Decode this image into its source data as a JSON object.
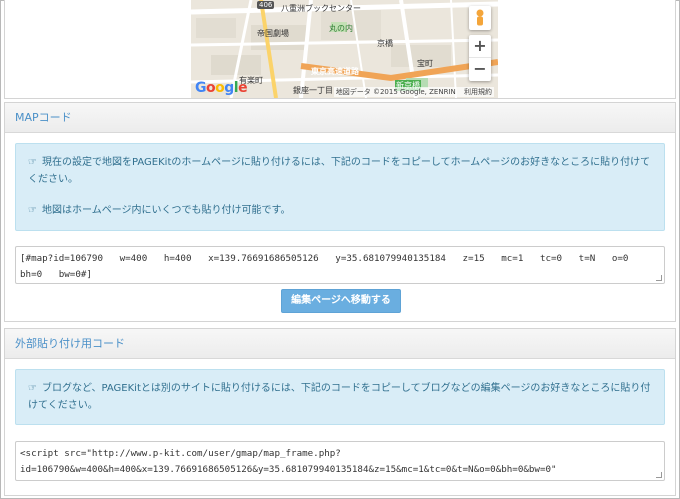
{
  "map": {
    "labels": {
      "route": "406",
      "yaesu": "八重洲ブックセンター",
      "marunouchi": "丸の内",
      "kyobashi": "京橋",
      "tokyo_square": "東京スクエアガーデン",
      "imperial": "帝国劇場",
      "takaracho": "宝町",
      "yurakucho": "有楽町",
      "expressway": "東京高速道路",
      "ginza_itchome": "銀座一丁目",
      "shinkyobashi": "新京橋"
    },
    "logo": "Google",
    "attribution": "地図データ ©2015 Google, ZENRIN",
    "terms": "利用規約",
    "zoom_in": "+",
    "zoom_out": "−"
  },
  "map_code": {
    "title": "MAPコード",
    "info_line1": "現在の設定で地図をPAGEKitのホームページに貼り付けるには、下記のコードをコピーしてホームページのお好きなところに貼り付けてください。",
    "info_line2": "地図はホームページ内にいくつでも貼り付け可能です。",
    "code": "[#map?id=106790   w=400   h=400   x=139.76691686505126   y=35.681079940135184   z=15   mc=1   tc=0   t=N   o=0\nbh=0   bw=0#]",
    "button": "編集ページへ移動する"
  },
  "external_code": {
    "title": "外部貼り付け用コード",
    "info": "ブログなど、PAGEKitとは別のサイトに貼り付けるには、下記のコードをコピーしてブログなどの編集ページのお好きなところに貼り付けてください。",
    "code": "<script src=\"http://www.p-kit.com/user/gmap/map_frame.php?\nid=106790&w=400&h=400&x=139.76691686505126&y=35.681079940135184&z=15&mc=1&tc=0&t=N&o=0&bh=0&bw=0\""
  }
}
